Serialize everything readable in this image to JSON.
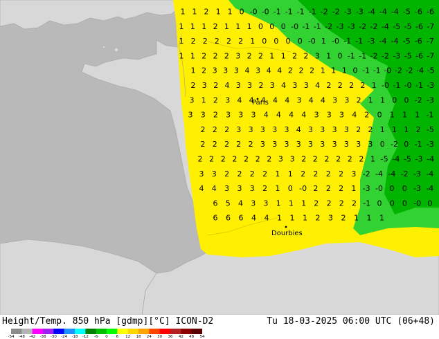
{
  "title": "Height/Temp. 850 hPa [gdmp][°C] ICON-D2",
  "datetime": "Tu 18-03-2025 06:00 UTC (06+48)",
  "cities": [
    "Paris",
    "Dourbies"
  ],
  "legend": {
    "labels": [
      "-54",
      "-48",
      "-42",
      "-38",
      "-30",
      "-24",
      "-18",
      "-12",
      "-6",
      "0",
      "6",
      "12",
      "18",
      "24",
      "30",
      "36",
      "42",
      "48",
      "54"
    ],
    "colors": [
      "#8c8c8c",
      "#b4b4b4",
      "#ff00ff",
      "#a020f0",
      "#0000ff",
      "#1e90ff",
      "#00ffff",
      "#008000",
      "#00c000",
      "#00ff00",
      "#ffff00",
      "#ffd700",
      "#ffa500",
      "#ff4500",
      "#ff0000",
      "#b22222",
      "#8b0000",
      "#5a0000"
    ]
  },
  "colors": {
    "sea": "#b9b9b9",
    "land": "#d8d8d8",
    "yellow_field": "#ffef00",
    "green_light": "#32d232",
    "green_dark": "#00b400"
  },
  "rows": [
    "1 1 2 1 1 0 -0 -0 -1 -1 -1 -1 -2 -2 -3 -3 -4 -4 -4 -5 -6 -6",
    "1 1 1 2 1 1 1 0 0 0 -0 -1 -1 -2 -3 -3 -2 -2 -4 -5 -5 -6 -7",
    "1 2 2 2 2 2 1 0 0 0 0 -0 1 -0 -1 -1 -3 -4 -4 -5 -6 -7",
    "1 1 2 2 2 3 2 2 1 1 2 2 3 1 0 -1 -1 -2 -2 -3 -5 -6 -7",
    "1 2 3 3 3 4 3 4 4 2 2 2 1 1 1 0 -1 -1 -0 -2 -2 -4 -5",
    "2 3 2 4 3 3 2 3 4 3 3 4 2 2 2 2 1 -0 -1 -0 -1 -3",
    "3 1 2 3 4 4 4 4 4 3 4 4 3 3 2 1 1 0 0 -2 -3",
    "3 3 2 3 3 3 4 4 4 4 3 3 3 4 2 0 1 1 1 -1",
    "2 2 2 3 3 3 3 3 4 3 3 3 3 2 2 1 1 1 2 -5",
    "2 2 2 2 2 3 3 3 3 3 3 3 3 3 3 0 -2 0 -1 -3",
    "2 2 2 2 2 2 2 3 3 2 2 2 2 2 2 1 -5 -4 -5 -3 -4",
    "3 3 2 2 2 2 1 1 2 2 2 2 3 -2 -4 -4 -2 -3 -4",
    "4 4 3 3 3 2 1 0 -0 2 2 2 1 -3 -0 0 0 -3 -4",
    "6 5 4 3 3 1 1 1 2 2 2 2 -1 0 0 0 -0 0",
    "6 6 6 4 4 1 1 1 2 3 2 1 1 1"
  ]
}
